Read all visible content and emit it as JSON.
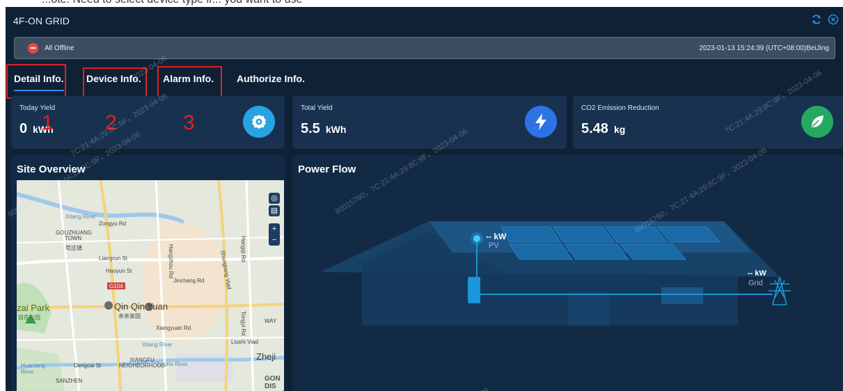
{
  "top_strip_text": "...ote: Need to select device type if... you want to use",
  "window": {
    "title": "4F-ON GRID",
    "refresh_icon": "refresh-icon",
    "close_icon": "close-icon",
    "accent": "#2e8cf0"
  },
  "status": {
    "text": "All Offline",
    "datetime": "2023-01-13 15:24:39 (UTC+08:00)BeiJing",
    "color": "#e84a4a"
  },
  "tabs": [
    {
      "label": "Detail Info.",
      "active": true
    },
    {
      "label": "Device Info.",
      "active": false
    },
    {
      "label": "Alarm Info.",
      "active": false
    },
    {
      "label": "Authorize Info.",
      "active": false
    }
  ],
  "annotations": [
    "1",
    "2",
    "3"
  ],
  "cards": [
    {
      "label": "Today Yield",
      "value": "0",
      "unit": "kWh",
      "icon": "gear-icon",
      "color": "#27a3e3"
    },
    {
      "label": "Total Yield",
      "value": "5.5",
      "unit": "kWh",
      "icon": "lightning-icon",
      "color": "#2e73e6"
    },
    {
      "label": "CO2 Emission Reduction",
      "value": "5.48",
      "unit": "kg",
      "icon": "leaf-icon",
      "color": "#25a860"
    }
  ],
  "site_overview": {
    "title": "Site Overview",
    "controls": [
      "locate-icon",
      "layers-icon",
      "+",
      "−"
    ],
    "map_labels": {
      "xitang_river": "Xitang River",
      "zongyu_rd": "Zongyu Rd",
      "gouzhuang_town": "GOUZHUANG TOWN",
      "gouzhuang_cn": "苟庄镇",
      "liangrun_st": "Liangrun St",
      "haoyun_st": "Haoyun St",
      "g104": "G104",
      "jinchang_rd": "Jinchang Rd",
      "hangzhou_rd": "Hangzhou Rd",
      "zai_park": "zai Park",
      "zai_park_cn": "自在公园",
      "qin_qin_yuan": "Qin Qin Yuan",
      "qin_qin_cn": "亲亲家园",
      "xiangyuan_rd": "Xiangyuan Rd",
      "xitang_river2": "Xitang River",
      "xiangfu": "XIANGFU NEIGHBORHOOD",
      "xiaohe_river": "Xiaohe River",
      "huantang": "Huantang River",
      "dengcai_st": "Dengcai St",
      "sanzhen": "SANZHEN",
      "shangtang_viad": "Shangtang Viad",
      "liushi_viad": "Liushi Viad",
      "zheji": "Zheji",
      "gon_dis": "GON DIS",
      "way": "WAY",
      "hangqi_rd": "Hangqi Rd",
      "tongyi_rd": "Tongyi Rd"
    }
  },
  "power_flow": {
    "title": "Power Flow",
    "pv_value": "-- kW",
    "pv_label": "PV",
    "grid_value": "-- kW",
    "grid_label": "Grid"
  },
  "watermarks": [
    "2023-04-06",
    "7C:21:4A:29:8C:9F，2023-04-06",
    "7C:21:4A:29:8C:9F，2023-04-06",
    "80015760，7C:21:4A:29:8C:9F，2023-04-06",
    "80015760，7C:21:4A:29:8C:9F，2023-04-06",
    "80015760，7C:21:4A:29:8C:9F，2023-04-06",
    "06"
  ]
}
